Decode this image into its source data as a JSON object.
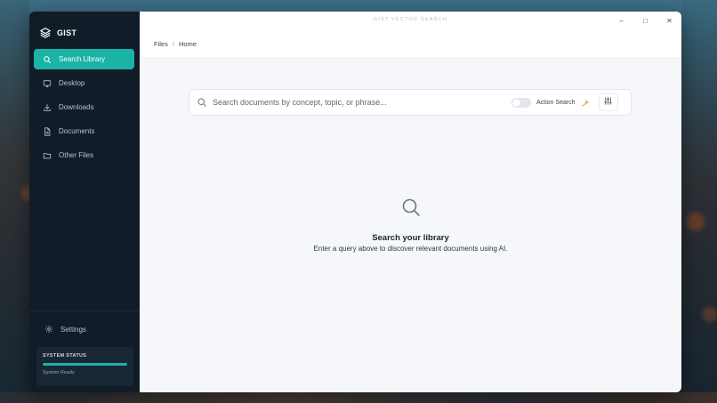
{
  "app": {
    "brand": "GIST",
    "window_title": "GIST VECTOR SEARCH"
  },
  "sidebar": {
    "items": [
      {
        "label": "Search Library",
        "icon": "search-icon",
        "active": true
      },
      {
        "label": "Desktop",
        "icon": "desktop-icon",
        "active": false
      },
      {
        "label": "Downloads",
        "icon": "download-icon",
        "active": false
      },
      {
        "label": "Documents",
        "icon": "document-icon",
        "active": false
      },
      {
        "label": "Other Files",
        "icon": "folder-icon",
        "active": false
      }
    ],
    "settings_label": "Settings",
    "status": {
      "title": "SYSTEM STATUS",
      "text": "System Ready",
      "progress": 1.0
    }
  },
  "window_controls": {
    "minimize": "–",
    "maximize": "□",
    "close": "✕"
  },
  "breadcrumb": {
    "root": "Files",
    "separator": "/",
    "current": "Home"
  },
  "search": {
    "placeholder": "Search documents by concept, topic, or phrase...",
    "value": "",
    "action_label": "Action Search",
    "action_enabled": false
  },
  "empty_state": {
    "title": "Search your library",
    "subtitle": "Enter a query above to discover relevant documents using AI."
  },
  "colors": {
    "accent": "#1bb3a6",
    "sidebar_bg": "#111c29",
    "bolt": "#e0a82e"
  }
}
